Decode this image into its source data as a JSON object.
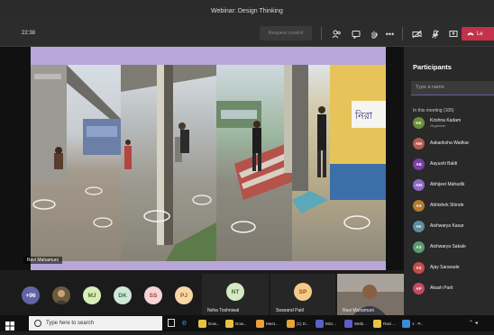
{
  "window": {
    "title": "Webinar: Design Thinking"
  },
  "toolbar": {
    "timer": "22:38",
    "request_control": "Request control",
    "leave_label": "Le",
    "icons": [
      "share-tray-icon",
      "participants-icon",
      "chat-icon",
      "raise-hand-icon",
      "more-icon",
      "camera-off-icon",
      "mic-off-icon",
      "share-screen-icon",
      "hang-up-icon"
    ]
  },
  "stage": {
    "presenter_name": "Ravi Mahamuni"
  },
  "participants": {
    "title": "Participants",
    "search_placeholder": "Type a name",
    "section": "In this meeting (105)",
    "list": [
      {
        "initials": "KK",
        "name": "Krishna Kadam",
        "role": "Organizer",
        "color": "#6a8e3a"
      },
      {
        "initials": "AW",
        "name": "Aakanksha Wadkar",
        "role": "",
        "color": "#b45a4e"
      },
      {
        "initials": "AB",
        "name": "Aayushi Baldi",
        "role": "",
        "color": "#7a3ea8"
      },
      {
        "initials": "AM",
        "name": "Abhijeet Mahadik",
        "role": "",
        "color": "#8e6bc8"
      },
      {
        "initials": "AS",
        "name": "Abhishek Shinde",
        "role": "",
        "color": "#b3792e"
      },
      {
        "initials": "AK",
        "name": "Aishwarya Kasar",
        "role": "",
        "color": "#5a8f9a"
      },
      {
        "initials": "AS",
        "name": "Aishwarya Sakale",
        "role": "",
        "color": "#5a9a6e"
      },
      {
        "initials": "AS",
        "name": "Ajay Saravade",
        "role": "",
        "color": "#c74a4a"
      },
      {
        "initials": "AP",
        "name": "Akash Parit",
        "role": "",
        "color": "#c44a62"
      }
    ]
  },
  "strip": {
    "overflow": "+96",
    "avatars": [
      {
        "initials": "MJ",
        "color": "#d9edb8",
        "text": "#4b6b2b"
      },
      {
        "initials": "DK",
        "color": "#cfe8d8",
        "text": "#3d6b55"
      },
      {
        "initials": "SS",
        "color": "#f4d4d4",
        "text": "#9a4444"
      },
      {
        "initials": "PJ",
        "color": "#f9d6a8",
        "text": "#9a5c1f"
      }
    ],
    "tiles": [
      {
        "initials": "NT",
        "name": "Neha Toshniwal",
        "color": "#d4e9c4",
        "text": "#4b6b2b"
      },
      {
        "initials": "SP",
        "name": "Swarand Patil",
        "color": "#f4c98a",
        "text": "#8a5217"
      },
      {
        "initials": "",
        "name": "Ravi Mahamuni",
        "color": "",
        "text": ""
      }
    ]
  },
  "taskbar": {
    "search_placeholder": "Type here to search",
    "apps": [
      {
        "label": "Dow...",
        "color": "#e8c341"
      },
      {
        "label": "Dow...",
        "color": "#e8c341"
      },
      {
        "label": "Meet...",
        "color": "#e8a23a"
      },
      {
        "label": "(1) D...",
        "color": "#e8a23a"
      },
      {
        "label": "Micr...",
        "color": "#5b5fc7"
      },
      {
        "label": "Webi...",
        "color": "#5b5fc7"
      },
      {
        "label": "Ravi ...",
        "color": "#e8c341"
      },
      {
        "label": "1 - P...",
        "color": "#3a8bd6"
      }
    ]
  },
  "colors": {
    "slide_bg": "#b9a6d8",
    "leave": "#c4314b",
    "accent": "#6264a7"
  }
}
